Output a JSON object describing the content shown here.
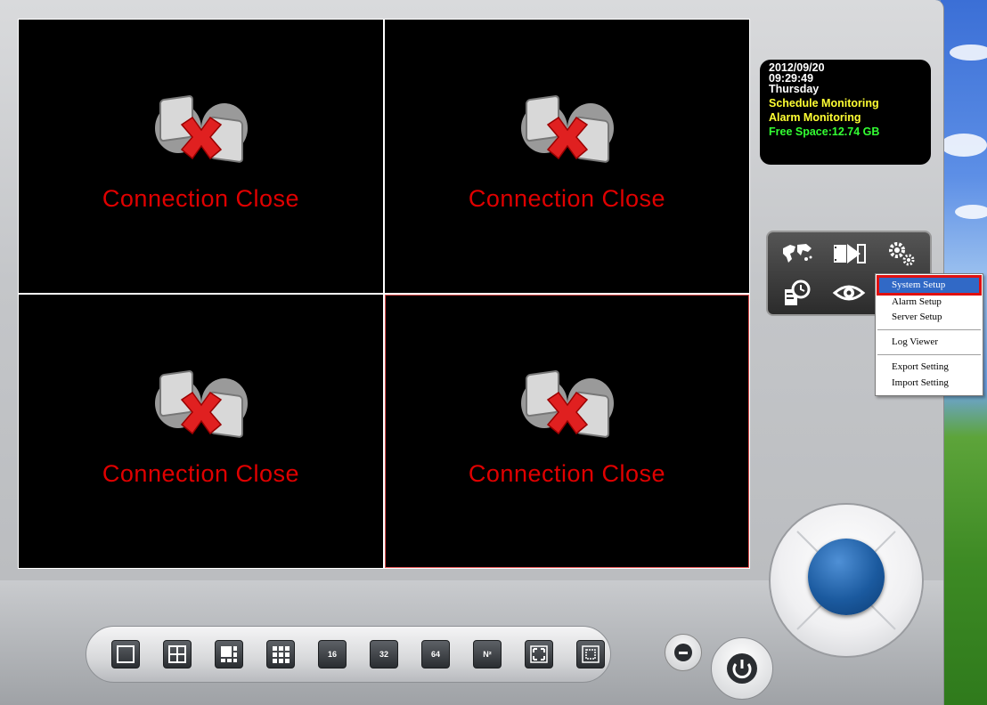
{
  "info_panel": {
    "date": "2012/09/20",
    "time": "09:29:49",
    "weekday": "Thursday",
    "schedule": "Schedule Monitoring",
    "alarm": "Alarm Monitoring",
    "free_space": "Free Space:12.74 GB"
  },
  "channels": [
    {
      "status": "Connection Close"
    },
    {
      "status": "Connection Close"
    },
    {
      "status": "Connection Close"
    },
    {
      "status": "Connection Close"
    }
  ],
  "menu": {
    "items": [
      "System Setup",
      "Alarm Setup",
      "Server Setup",
      "Log Viewer",
      "Export Setting",
      "Import Setting"
    ],
    "selected": "System Setup"
  },
  "toolbar": {
    "layout_labels": [
      "16",
      "32",
      "64",
      "N²"
    ]
  },
  "colors": {
    "status_text": "#e00000",
    "info_yellow": "#ffff33",
    "info_green": "#33ff33",
    "menu_highlight": "#3169c6"
  }
}
